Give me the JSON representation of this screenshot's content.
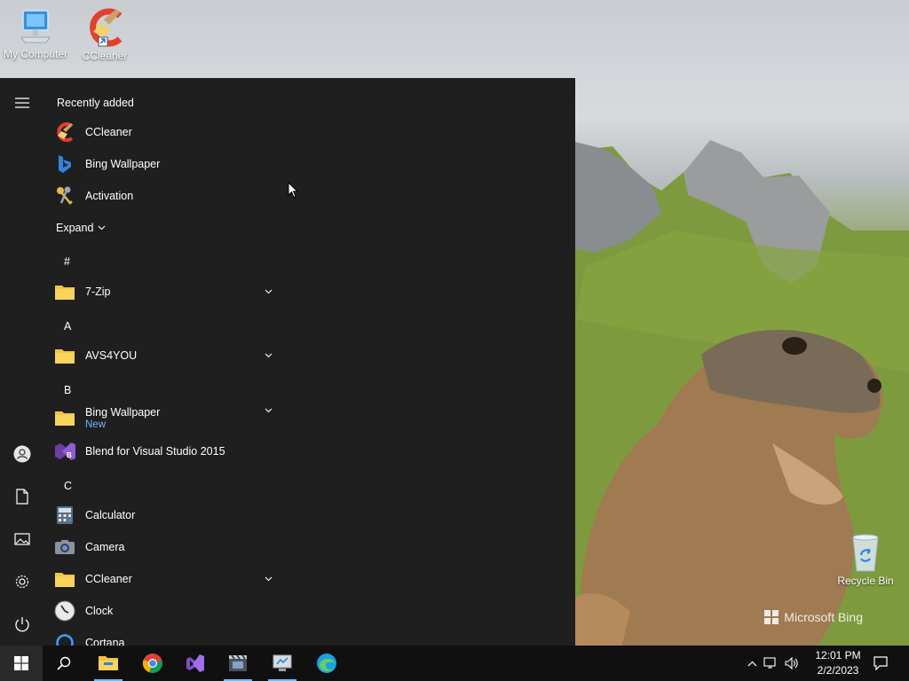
{
  "desktop": {
    "icons": [
      {
        "label": "My Computer"
      },
      {
        "label": "CCleaner"
      },
      {
        "label": "Recycle Bin"
      }
    ],
    "watermark": "Microsoft Bing"
  },
  "start_menu": {
    "recently_added_title": "Recently added",
    "recent": [
      {
        "label": "CCleaner"
      },
      {
        "label": "Bing Wallpaper"
      },
      {
        "label": "Activation"
      }
    ],
    "expand_label": "Expand",
    "groups": [
      {
        "letter": "#",
        "items": [
          {
            "label": "7-Zip",
            "folder": true
          }
        ]
      },
      {
        "letter": "A",
        "items": [
          {
            "label": "AVS4YOU",
            "folder": true
          }
        ]
      },
      {
        "letter": "B",
        "items": [
          {
            "label": "Bing Wallpaper",
            "folder": true,
            "badge": "New"
          },
          {
            "label": "Blend for Visual Studio 2015",
            "folder": false
          }
        ]
      },
      {
        "letter": "C",
        "items": [
          {
            "label": "Calculator",
            "folder": false
          },
          {
            "label": "Camera",
            "folder": false
          },
          {
            "label": "CCleaner",
            "folder": true
          },
          {
            "label": "Clock",
            "folder": false
          },
          {
            "label": "Cortana",
            "folder": false
          }
        ]
      }
    ]
  },
  "taskbar": {
    "time": "12:01 PM",
    "date": "2/2/2023",
    "accent": "#76b9ed"
  },
  "colors": {
    "start_bg": "#1f1f1f",
    "taskbar_bg": "#101010",
    "folder": "#f4c542",
    "new_badge": "#6cb6ff"
  }
}
